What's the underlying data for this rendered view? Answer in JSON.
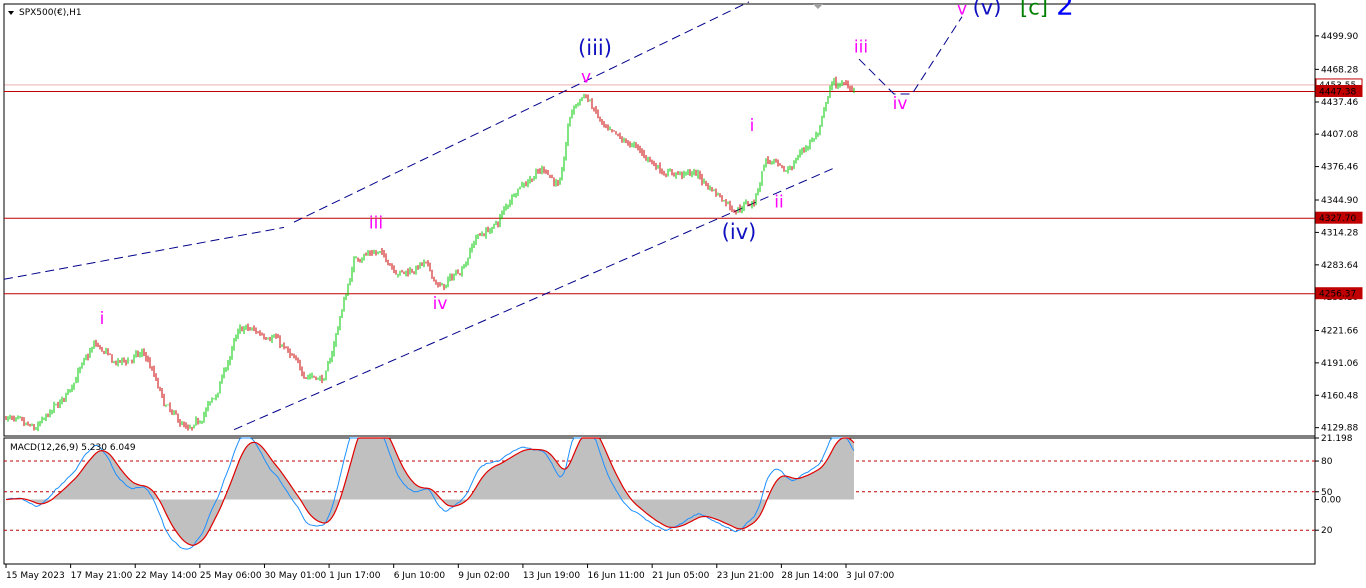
{
  "chart_data": {
    "type": "candlestick",
    "symbol_label": "SPX500(€),H1",
    "colors": {
      "bull": "#00c800",
      "bear": "#c80000",
      "wick": "#000000",
      "hline": "#c00000",
      "channel": "#00008b",
      "macd_line": "#1e90ff",
      "signal_line": "#e00000",
      "histogram": "#c0c0c0",
      "wave_minor": "#ff00ff",
      "wave_major": "#1010c0",
      "wave_c": "#008000",
      "wave_2": "#0000ff"
    },
    "price_axis": {
      "range": [
        4122,
        4530
      ],
      "ticks": [
        4499.9,
        4468.28,
        4437.46,
        4407.08,
        4376.46,
        4344.9,
        4314.28,
        4283.64,
        4253.1,
        4221.66,
        4191.06,
        4160.48,
        4129.88
      ],
      "tick_labels": [
        "4499.90",
        "4468.28",
        "4437.46",
        "4407.08",
        "4376.46",
        "4344.90",
        "4314.28",
        "4283.64",
        "4253.10",
        "4221.66",
        "4191.06",
        "4160.48",
        "4129.88"
      ]
    },
    "price_tags": [
      {
        "label": "4453.55",
        "value": 4453.55,
        "style": "outline"
      },
      {
        "label": "4447.38",
        "value": 4447.38,
        "style": "filled"
      },
      {
        "label": "4327.70",
        "value": 4327.7,
        "style": "filled"
      },
      {
        "label": "4256.37",
        "value": 4256.37,
        "style": "filled"
      }
    ],
    "horizontal_levels": [
      4453.55,
      4447.38,
      4327.7,
      4256.37
    ],
    "time_axis": {
      "labels": [
        "15 May 2023",
        "17 May 21:00",
        "22 May 14:00",
        "25 May 06:00",
        "30 May 01:00",
        "1 Jun 17:00",
        "6 Jun 10:00",
        "9 Jun 02:00",
        "13 Jun 19:00",
        "16 Jun 11:00",
        "21 Jun 05:00",
        "23 Jun 21:00",
        "28 Jun 14:00",
        "3 Jul 07:00"
      ]
    },
    "price_path": [
      [
        0,
        4140
      ],
      [
        30,
        4128
      ],
      [
        60,
        4160
      ],
      [
        90,
        4210
      ],
      [
        110,
        4190
      ],
      [
        140,
        4200
      ],
      [
        160,
        4150
      ],
      [
        185,
        4125
      ],
      [
        210,
        4160
      ],
      [
        235,
        4225
      ],
      [
        270,
        4215
      ],
      [
        300,
        4180
      ],
      [
        320,
        4175
      ],
      [
        335,
        4235
      ],
      [
        350,
        4292
      ],
      [
        375,
        4295
      ],
      [
        395,
        4275
      ],
      [
        420,
        4285
      ],
      [
        435,
        4260
      ],
      [
        460,
        4285
      ],
      [
        470,
        4310
      ],
      [
        490,
        4320
      ],
      [
        510,
        4355
      ],
      [
        540,
        4375
      ],
      [
        555,
        4355
      ],
      [
        565,
        4430
      ],
      [
        580,
        4445
      ],
      [
        600,
        4410
      ],
      [
        630,
        4395
      ],
      [
        660,
        4370
      ],
      [
        690,
        4370
      ],
      [
        730,
        4335
      ],
      [
        750,
        4345
      ],
      [
        760,
        4385
      ],
      [
        780,
        4370
      ],
      [
        800,
        4395
      ],
      [
        815,
        4410
      ],
      [
        825,
        4455
      ],
      [
        850,
        4452
      ]
    ],
    "wave_labels": [
      {
        "text": "i",
        "series": "minor",
        "bar": 98,
        "price": 4228
      },
      {
        "text": "iii",
        "series": "minor",
        "bar": 372,
        "price": 4318
      },
      {
        "text": "iv",
        "series": "minor",
        "bar": 436,
        "price": 4242
      },
      {
        "text": "v",
        "series": "minor",
        "bar": 582,
        "price": 4456
      },
      {
        "text": "(iii)",
        "series": "major",
        "bar": 591,
        "price": 4482
      },
      {
        "text": "(iv)",
        "series": "major",
        "bar": 735,
        "price": 4308
      },
      {
        "text": "i",
        "series": "minor",
        "bar": 748,
        "price": 4410
      },
      {
        "text": "ii",
        "series": "minor",
        "bar": 775,
        "price": 4338
      },
      {
        "text": "iii",
        "series": "minor",
        "bar": 857,
        "price": 4484
      },
      {
        "text": "iv",
        "series": "minor",
        "bar": 896,
        "price": 4431
      },
      {
        "text": "v",
        "series": "minor",
        "bar": 958,
        "price": 4520
      },
      {
        "text": "(v)",
        "series": "major",
        "bar": 983,
        "price": 4520
      },
      {
        "text": "[c]",
        "series": "c",
        "bar": 1030,
        "price": 4520
      },
      {
        "text": "2",
        "series": "two",
        "bar": 1061,
        "price": 4520
      }
    ],
    "channel_lines": [
      {
        "points": [
          [
            0,
            4270
          ],
          [
            280,
            4319
          ]
        ]
      },
      {
        "points": [
          [
            290,
            4324
          ],
          [
            745,
            4532
          ]
        ]
      },
      {
        "points": [
          [
            230,
            4128
          ],
          [
            830,
            4375
          ]
        ]
      }
    ],
    "projection_path": [
      [
        855,
        4478
      ],
      [
        890,
        4445
      ],
      [
        908,
        4445
      ],
      [
        958,
        4518
      ]
    ],
    "macd": {
      "label": "MACD(12,26,9) 5.230 6.049",
      "range": [
        -42,
        40
      ],
      "tick_labels": [
        "21.198",
        "80",
        "50",
        "0.00",
        "20"
      ],
      "tick_values": [
        40,
        25,
        5,
        0,
        -20
      ],
      "levels": [
        25,
        5,
        -20
      ]
    },
    "current_marker_bar": 820
  }
}
